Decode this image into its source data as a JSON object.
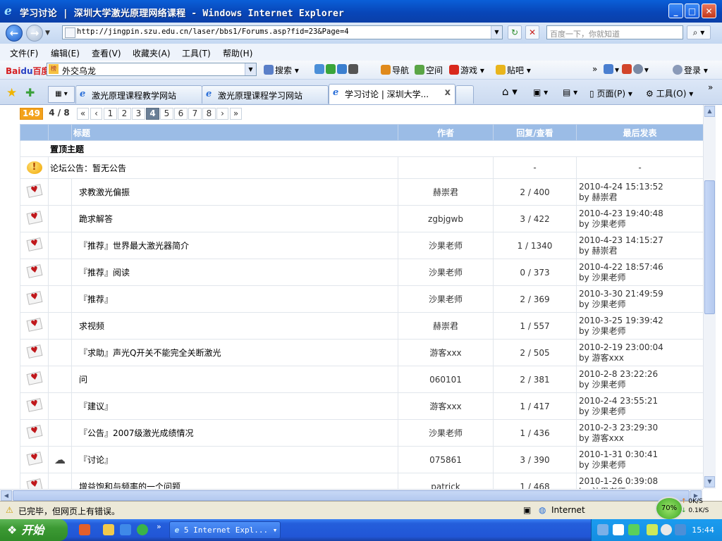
{
  "window": {
    "title": "学习讨论 | 深圳大学激光原理网络课程 - Windows Internet Explorer",
    "min": "_",
    "max": "□",
    "close": "✕",
    "ie_glyph": "e"
  },
  "address_bar": {
    "url": "http://jingpin.szu.edu.cn/laser/bbs1/Forums.asp?fid=23&Page=4",
    "search_placeholder": "百度一下，你就知道",
    "back": "←",
    "forward": "→",
    "refresh": "↻",
    "stop": "✕",
    "search_glyph": "⌕"
  },
  "menu": [
    "文件(F)",
    "编辑(E)",
    "查看(V)",
    "收藏夹(A)",
    "工具(T)",
    "帮助(H)"
  ],
  "baidu_toolbar": {
    "logo_a": "Bai",
    "logo_b": "du",
    "logo_c": "百度",
    "hot_badge": "榜",
    "input": "外交乌龙",
    "search": "搜索",
    "nav": "导航",
    "space": "空间",
    "games": "游戏",
    "tieba": "贴吧",
    "login": "登录"
  },
  "tabs": [
    {
      "label": "激光原理课程教学网站"
    },
    {
      "label": "激光原理课程学习网站"
    },
    {
      "label": "学习讨论 | 深圳大学..."
    }
  ],
  "commands": {
    "page": "页面(P)",
    "tools": "工具(O)"
  },
  "pager": {
    "total": "149",
    "count": "4 / 8",
    "items": [
      "«",
      "‹",
      "1",
      "2",
      "3",
      "4",
      "5",
      "6",
      "7",
      "8",
      "›",
      "»"
    ],
    "current": "4"
  },
  "table": {
    "headers": {
      "title": "标题",
      "author": "作者",
      "replies": "回复/查看",
      "last": "最后发表"
    },
    "section": "置顶主题",
    "announcement": {
      "title": "论坛公告：暂无公告",
      "replies": "-",
      "last": "-"
    },
    "rows": [
      {
        "title": "求教激光偏振",
        "author": "赫崇君",
        "stats": "2 / 400",
        "time": "2010-4-24 15:13:52",
        "by": "by 赫崇君"
      },
      {
        "title": "跪求解答",
        "author": "zgbjgwb",
        "stats": "3 / 422",
        "time": "2010-4-23 19:40:48",
        "by": "by 沙果老师"
      },
      {
        "title": "『推荐』世界最大激光器简介",
        "author": "沙果老师",
        "stats": "1 / 1340",
        "time": "2010-4-23 14:15:27",
        "by": "by 赫崇君"
      },
      {
        "title": "『推荐』阅读",
        "author": "沙果老师",
        "stats": "0 / 373",
        "time": "2010-4-22 18:57:46",
        "by": "by 沙果老师"
      },
      {
        "title": "『推荐』",
        "author": "沙果老师",
        "stats": "2 / 369",
        "time": "2010-3-30 21:49:59",
        "by": "by 沙果老师"
      },
      {
        "title": "求视频",
        "author": "赫崇君",
        "stats": "1 / 557",
        "time": "2010-3-25 19:39:42",
        "by": "by 沙果老师"
      },
      {
        "title": "『求助』声光Q开关不能完全关断激光",
        "author": "游客xxx",
        "stats": "2 / 505",
        "time": "2010-2-19 23:00:04",
        "by": "by 游客xxx"
      },
      {
        "title": "问",
        "author": "060101",
        "stats": "2 / 381",
        "time": "2010-2-8 23:22:26",
        "by": "by 沙果老师"
      },
      {
        "title": "『建议』",
        "author": "游客xxx",
        "stats": "1 / 417",
        "time": "2010-2-4 23:55:21",
        "by": "by 沙果老师"
      },
      {
        "title": "『公告』2007级激光成绩情况",
        "author": "沙果老师",
        "stats": "1 / 436",
        "time": "2010-2-3 23:29:30",
        "by": "by 游客xxx"
      },
      {
        "title": "『讨论』",
        "author": "075861",
        "stats": "3 / 390",
        "time": "2010-1-31 0:30:41",
        "by": "by 沙果老师"
      },
      {
        "title": "增益饱和与频率的一个问题",
        "author": "patrick",
        "stats": "1 / 468",
        "time": "2010-1-26 0:39:08",
        "by": "by 沙果老师"
      }
    ]
  },
  "status": {
    "text": "已完毕，但网页上有错误。",
    "zone": "Internet",
    "speed": "70%",
    "up_rate": "0K/S",
    "down_rate": "0.1K/S",
    "up_arrow": "↑",
    "down_arrow": "↓"
  },
  "taskbar": {
    "start": "开始",
    "item": "5 Internet Expl...",
    "clock": "15:44",
    "more": "»"
  },
  "colors": {
    "header_bg": "#9bbce6",
    "pager_total": "#f3a21b",
    "pager_current": "#6a7f96",
    "titlebar": "#0846b8",
    "taskbar": "#245edb"
  }
}
